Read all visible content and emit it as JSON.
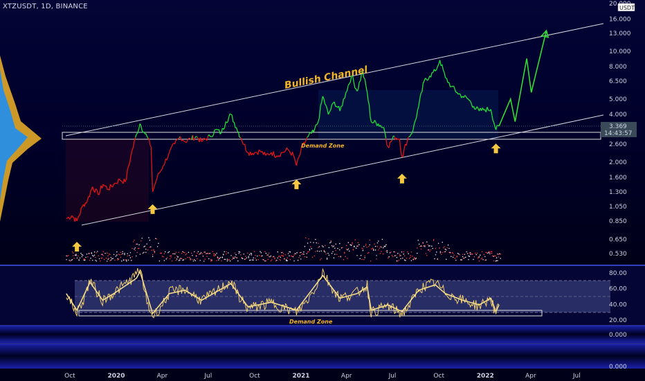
{
  "header": {
    "symbol_line": "XTZUSDT, 1D, BINANCE"
  },
  "colors": {
    "background": "#000018",
    "bull": "#22e03a",
    "bear": "#e01616",
    "channel": "#d8d8e0",
    "projection": "#33dd33",
    "arrow": "#f5c842",
    "annotation": "#f0b429",
    "rsi_line": "#f0cf6a",
    "rsi_band": "#2a2f68",
    "price_tag": "#3a4a58"
  },
  "chart_data": [
    {
      "type": "line",
      "scale": "log",
      "x_tick_labels": [
        "Oct",
        "2020",
        "Apr",
        "Jul",
        "Oct",
        "2021",
        "Apr",
        "Jul",
        "Oct",
        "2022",
        "Apr",
        "Jul"
      ],
      "y_tick_labels": [
        "20.000",
        "16.000",
        "13.000",
        "10.000",
        "8.000",
        "6.500",
        "5.000",
        "4.000",
        "3.369",
        "2.600",
        "2.000",
        "1.600",
        "1.300",
        "1.050",
        "0.850",
        "0.650",
        "0.530"
      ],
      "ylim": [
        0.48,
        20.0
      ],
      "price_tag": {
        "value": "3.369",
        "countdown": "14:43:57",
        "unit": "USDT"
      },
      "series": [
        {
          "kind": "price",
          "points": [
            [
              "2019-09-24",
              0.88
            ],
            [
              "2019-10-05",
              0.92
            ],
            [
              "2019-10-15",
              0.85
            ],
            [
              "2019-10-26",
              1.05
            ],
            [
              "2019-11-05",
              1.15
            ],
            [
              "2019-11-15",
              1.4
            ],
            [
              "2019-11-26",
              1.25
            ],
            [
              "2019-12-06",
              1.45
            ],
            [
              "2019-12-16",
              1.35
            ],
            [
              "2019-12-27",
              1.45
            ],
            [
              "2020-01-08",
              1.55
            ],
            [
              "2020-01-19",
              1.5
            ],
            [
              "2020-01-30",
              2.2
            ],
            [
              "2020-02-10",
              3.0
            ],
            [
              "2020-02-17",
              3.5
            ],
            [
              "2020-02-25",
              3.1
            ],
            [
              "2020-03-02",
              2.9
            ],
            [
              "2020-03-10",
              2.5
            ],
            [
              "2020-03-13",
              1.3
            ],
            [
              "2020-03-22",
              1.6
            ],
            [
              "2020-04-03",
              1.9
            ],
            [
              "2020-04-15",
              2.3
            ],
            [
              "2020-04-26",
              2.6
            ],
            [
              "2020-05-07",
              2.9
            ],
            [
              "2020-05-16",
              2.7
            ],
            [
              "2020-05-27",
              2.8
            ],
            [
              "2020-06-07",
              2.9
            ],
            [
              "2020-06-18",
              2.7
            ],
            [
              "2020-07-05",
              2.9
            ],
            [
              "2020-07-16",
              3.2
            ],
            [
              "2020-07-27",
              3.05
            ],
            [
              "2020-08-05",
              3.6
            ],
            [
              "2020-08-15",
              4.0
            ],
            [
              "2020-08-26",
              3.3
            ],
            [
              "2020-09-05",
              2.8
            ],
            [
              "2020-09-18",
              2.3
            ],
            [
              "2020-10-01",
              2.3
            ],
            [
              "2020-10-12",
              2.35
            ],
            [
              "2020-10-23",
              2.2
            ],
            [
              "2020-11-03",
              2.3
            ],
            [
              "2020-11-14",
              2.2
            ],
            [
              "2020-11-25",
              2.3
            ],
            [
              "2020-12-06",
              2.4
            ],
            [
              "2020-12-17",
              2.2
            ],
            [
              "2020-12-23",
              1.9
            ],
            [
              "2021-01-04",
              2.5
            ],
            [
              "2021-01-15",
              2.9
            ],
            [
              "2021-01-26",
              3.1
            ],
            [
              "2021-02-04",
              3.6
            ],
            [
              "2021-02-13",
              5.2
            ],
            [
              "2021-02-24",
              4.0
            ],
            [
              "2021-03-08",
              4.8
            ],
            [
              "2021-03-19",
              4.2
            ],
            [
              "2021-03-31",
              5.5
            ],
            [
              "2021-04-11",
              7.0
            ],
            [
              "2021-04-22",
              5.6
            ],
            [
              "2021-05-03",
              7.5
            ],
            [
              "2021-05-12",
              5.5
            ],
            [
              "2021-05-20",
              3.6
            ],
            [
              "2021-06-03",
              3.5
            ],
            [
              "2021-06-14",
              3.3
            ],
            [
              "2021-06-22",
              2.5
            ],
            [
              "2021-07-05",
              2.9
            ],
            [
              "2021-07-15",
              2.8
            ],
            [
              "2021-07-20",
              2.15
            ],
            [
              "2021-07-31",
              2.8
            ],
            [
              "2021-08-11",
              3.2
            ],
            [
              "2021-08-22",
              4.5
            ],
            [
              "2021-09-02",
              6.5
            ],
            [
              "2021-09-13",
              7.0
            ],
            [
              "2021-09-24",
              7.5
            ],
            [
              "2021-10-03",
              8.8
            ],
            [
              "2021-10-14",
              6.8
            ],
            [
              "2021-10-26",
              6.0
            ],
            [
              "2021-11-06",
              5.5
            ],
            [
              "2021-11-17",
              5.2
            ],
            [
              "2021-11-28",
              5.0
            ],
            [
              "2021-12-09",
              4.5
            ],
            [
              "2021-12-20",
              4.2
            ],
            [
              "2021-12-31",
              4.3
            ],
            [
              "2022-01-12",
              4.3
            ],
            [
              "2022-01-22",
              3.2
            ],
            [
              "2022-01-28",
              3.37
            ]
          ]
        },
        {
          "kind": "projection",
          "points": [
            [
              "2022-01-28",
              3.37
            ],
            [
              "2022-02-20",
              5.0
            ],
            [
              "2022-03-01",
              3.6
            ],
            [
              "2022-03-24",
              9.0
            ],
            [
              "2022-04-02",
              5.5
            ],
            [
              "2022-05-02",
              13.5
            ]
          ]
        },
        {
          "kind": "rsi",
          "ylim": [
            15,
            95
          ],
          "y_tick_labels": [
            "80.00",
            "60.00",
            "40.00",
            "20.00"
          ],
          "band": [
            30,
            70
          ],
          "points": [
            [
              "2019-09-24",
              55
            ],
            [
              "2019-10-15",
              30
            ],
            [
              "2019-11-10",
              72
            ],
            [
              "2019-12-05",
              45
            ],
            [
              "2019-12-27",
              55
            ],
            [
              "2020-02-10",
              78
            ],
            [
              "2020-02-17",
              88
            ],
            [
              "2020-03-13",
              25
            ],
            [
              "2020-04-15",
              55
            ],
            [
              "2020-05-16",
              60
            ],
            [
              "2020-06-18",
              45
            ],
            [
              "2020-08-15",
              70
            ],
            [
              "2020-09-18",
              35
            ],
            [
              "2020-11-03",
              42
            ],
            [
              "2020-12-23",
              30
            ],
            [
              "2021-02-13",
              82
            ],
            [
              "2021-03-19",
              48
            ],
            [
              "2021-04-22",
              55
            ],
            [
              "2021-05-12",
              65
            ],
            [
              "2021-05-20",
              30
            ],
            [
              "2021-06-22",
              38
            ],
            [
              "2021-07-20",
              28
            ],
            [
              "2021-08-22",
              60
            ],
            [
              "2021-09-24",
              68
            ],
            [
              "2021-10-14",
              55
            ],
            [
              "2021-11-17",
              45
            ],
            [
              "2021-12-20",
              38
            ],
            [
              "2022-01-12",
              48
            ],
            [
              "2022-01-22",
              28
            ],
            [
              "2022-01-28",
              38
            ]
          ]
        }
      ],
      "annotations": {
        "channel_label": "Bullish Channel",
        "demand_zone_price": "Demand Zone",
        "demand_zone_rsi": "Demand Zone"
      },
      "lower_panes": [
        {
          "y_tick_labels": [
            "0.000"
          ]
        },
        {
          "y_tick_labels": [
            "0.000"
          ]
        }
      ]
    }
  ]
}
